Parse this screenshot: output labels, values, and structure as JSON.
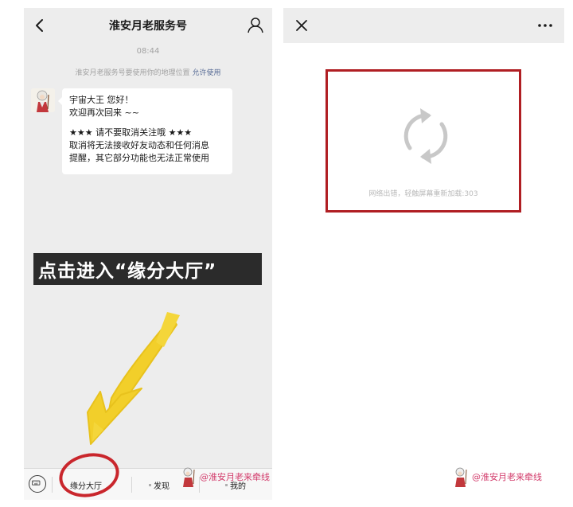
{
  "left": {
    "title": "淮安月老服务号",
    "time": "08:44",
    "notice": {
      "text": "淮安月老服务号要使用你的地理位置",
      "link": "允许使用"
    },
    "message": {
      "lines": [
        "宇宙大王 您好！",
        "欢迎再次回来 ~~",
        "",
        "★★★ 请不要取消关注哦 ★★★",
        "取消将无法接收好友动态和任何消息",
        "提醒，其它部分功能也无法正常使用"
      ]
    },
    "banner": "点击进入“缘分大厅”",
    "menu": {
      "items": [
        "缘分大厅",
        "发现",
        "我的"
      ]
    },
    "watermark": "@淮安月老来牵线"
  },
  "right": {
    "error_text": "网络出错，轻触屏幕重新加载:303",
    "watermark": "@淮安月老来牵线"
  },
  "colors": {
    "wechat_bg": "#ededed",
    "link": "#576b95",
    "highlight": "#b01e23",
    "arrow": "#f2cf2a"
  },
  "icons": {
    "back": "chevron-left-icon",
    "profile": "person-icon",
    "keyboard": "keyboard-icon",
    "close": "close-icon",
    "more": "more-dots-icon",
    "reload": "refresh-icon"
  }
}
